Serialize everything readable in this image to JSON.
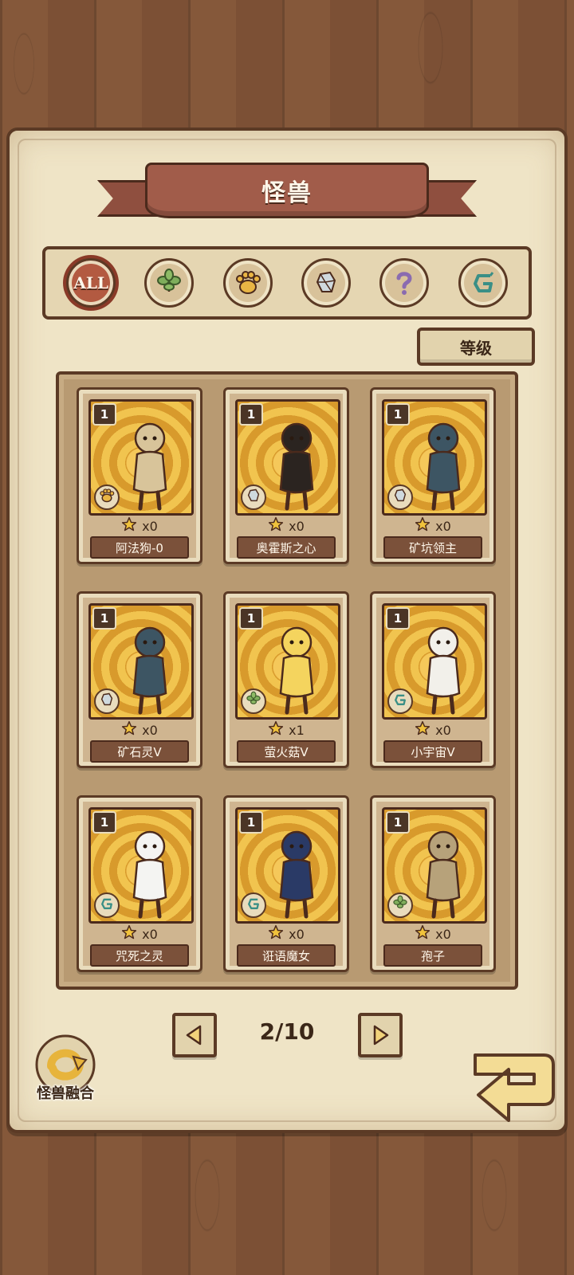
{
  "header": {
    "title": "怪兽"
  },
  "filters": [
    {
      "id": "all",
      "label": "ALL",
      "active": true,
      "icon": "all-icon"
    },
    {
      "id": "plant",
      "icon": "leaf-icon",
      "active": false
    },
    {
      "id": "beast",
      "icon": "paw-icon",
      "active": false
    },
    {
      "id": "mineral",
      "icon": "crystal-icon",
      "active": false
    },
    {
      "id": "unknown",
      "icon": "question-icon",
      "active": false
    },
    {
      "id": "arcane",
      "icon": "rune-icon",
      "active": false
    }
  ],
  "sort": {
    "label": "等级"
  },
  "cards": [
    {
      "level": "1",
      "count": "x0",
      "name": "阿法狗-0",
      "type_icon": "paw-icon",
      "color": "#d8c49a"
    },
    {
      "level": "1",
      "count": "x0",
      "name": "奥霍斯之心",
      "type_icon": "crystal-icon",
      "color": "#2b2420"
    },
    {
      "level": "1",
      "count": "x0",
      "name": "矿坑领主",
      "type_icon": "crystal-icon",
      "color": "#3d5563"
    },
    {
      "level": "1",
      "count": "x0",
      "name": "矿石灵V",
      "type_icon": "crystal-icon",
      "color": "#3d5563"
    },
    {
      "level": "1",
      "count": "x1",
      "name": "萤火菇V",
      "type_icon": "leaf-icon",
      "color": "#f4d45e"
    },
    {
      "level": "1",
      "count": "x0",
      "name": "小宇宙V",
      "type_icon": "rune-icon",
      "color": "#f2f0ea"
    },
    {
      "level": "1",
      "count": "x0",
      "name": "咒死之灵",
      "type_icon": "rune-icon",
      "color": "#f4f4f2"
    },
    {
      "level": "1",
      "count": "x0",
      "name": "诳语魔女",
      "type_icon": "rune-icon",
      "color": "#2a3a66"
    },
    {
      "level": "1",
      "count": "x0",
      "name": "孢子",
      "type_icon": "leaf-icon",
      "color": "#b7a27a"
    }
  ],
  "pager": {
    "label": "2/10"
  },
  "fusion": {
    "label": "怪兽融合"
  },
  "colors": {
    "accent": "#b35a41",
    "dark": "#5b3a25",
    "parchment": "#efe4c6"
  }
}
